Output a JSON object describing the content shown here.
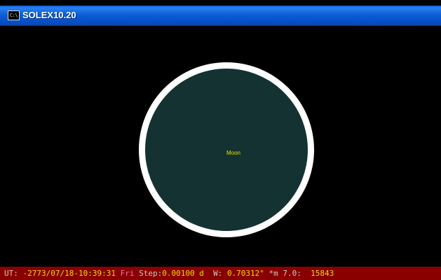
{
  "window": {
    "title": "SOLEX10.20",
    "icon": "console-icon",
    "icon_glyph": "C:\\"
  },
  "canvas": {
    "background_color": "#000000",
    "body": {
      "label": "Moon",
      "fill_color": "#143232",
      "ring_color": "#ffffff",
      "label_color": "#f0e000"
    }
  },
  "status": {
    "ut_label": "UT:",
    "ut_value": "-2773/07/18-10:39:31",
    "day": "Fri",
    "step_label": "Step:",
    "step_value": "0.00100 d",
    "w_label": "W:",
    "w_value": "0.70312°",
    "mag_label": "*m 7.0:",
    "count_value": "15843",
    "background_color": "#8a0000"
  }
}
